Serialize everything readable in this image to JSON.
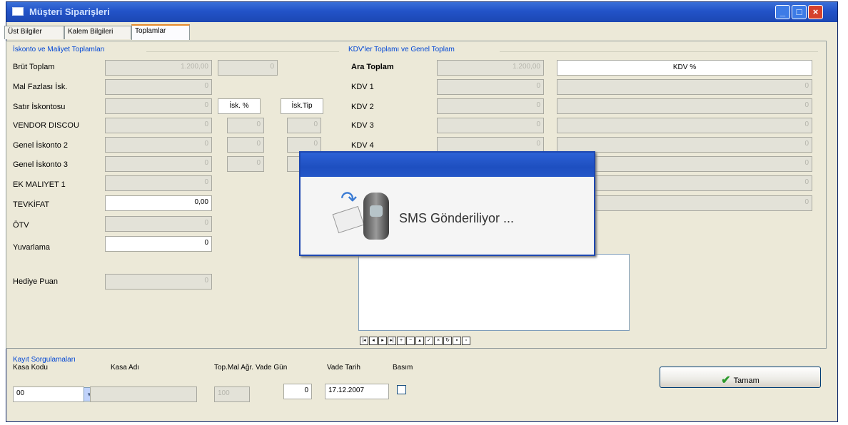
{
  "window": {
    "title": "Müşteri Siparişleri",
    "controls": [
      "minimize-icon",
      "maximize-icon",
      "close-icon"
    ]
  },
  "tabs": [
    {
      "label": "Üst Bilgiler",
      "active": false
    },
    {
      "label": "Kalem Bilgileri",
      "active": false
    },
    {
      "label": "Toplamlar",
      "active": true
    }
  ],
  "discount_group": {
    "title": "İskonto ve Maliyet Toplamları",
    "rows": [
      {
        "label": "Brüt Toplam",
        "value": "1.200,00",
        "extra": "0"
      },
      {
        "label": "Mal Fazlası İsk.",
        "value": "0"
      },
      {
        "label": "Satır İskontosu",
        "value": "0"
      },
      {
        "label": "VENDOR DISCOU",
        "value": "0",
        "pct": "0",
        "tip": "0"
      },
      {
        "label": "Genel İskonto 2",
        "value": "0",
        "pct": "0",
        "tip": "0"
      },
      {
        "label": "Genel İskonto 3",
        "value": "0",
        "pct": "0",
        "tip": "0"
      },
      {
        "label": "EK MALIYET 1",
        "value": "0"
      },
      {
        "label": "TEVKİFAT",
        "value": "0,00"
      },
      {
        "label": "ÖTV",
        "value": "0"
      },
      {
        "label": "Yuvarlama",
        "value": "0"
      }
    ],
    "col_pct_header": "İsk. %",
    "col_tip_header": "İsk.Tip",
    "gift_label": "Hediye Puan",
    "gift_value": "0"
  },
  "vat_group": {
    "title": "KDV'ler Toplamı ve Genel Toplam",
    "rows": [
      {
        "label": "Ara Toplam",
        "value": "1.200,00",
        "bold": true
      },
      {
        "label": "KDV 1",
        "value": "0",
        "pct": "0"
      },
      {
        "label": "KDV 2",
        "value": "0",
        "pct": "0"
      },
      {
        "label": "KDV 3",
        "value": "0",
        "pct": "0"
      },
      {
        "label": "KDV 4",
        "value": "0",
        "pct": "0"
      }
    ],
    "pct_header": "KDV %",
    "extra_pct_rows": [
      "0",
      "0",
      "0"
    ]
  },
  "navigator_icons": [
    "first-icon",
    "prior-icon",
    "next-icon",
    "last-icon",
    "insert-icon",
    "delete-icon",
    "edit-icon",
    "post-icon",
    "cancel-icon",
    "refresh-icon",
    "apply-icon",
    "save-icon"
  ],
  "record_controls": {
    "title": "Kayıt Sorgulamaları",
    "kasa_kodu_label": "Kasa Kodu",
    "kasa_kodu_value": "00",
    "kasa_adi_label": "Kasa Adı",
    "kasa_adi_value": "",
    "top_mal_label": "Top.Mal Ağr.",
    "top_mal_value": "100",
    "vade_gun_label": "Vade Gün",
    "vade_gun_value": "0",
    "vade_tarih_label": "Vade Tarih",
    "vade_tarih_value": "17.12.2007",
    "basim_label": "Basım",
    "basim_checked": false
  },
  "ok_button": {
    "label": "Tamam",
    "icon": "check-icon"
  },
  "sms_dialog": {
    "message": "SMS Gönderiliyor ...",
    "icon": "sms-phone-icon"
  }
}
